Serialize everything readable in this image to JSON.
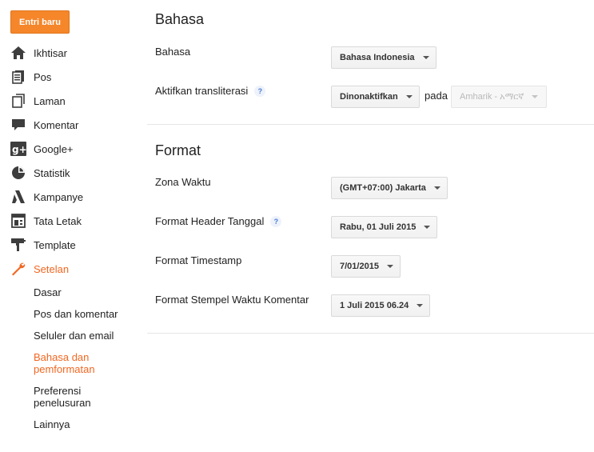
{
  "sidebar": {
    "new_post_label": "Entri baru",
    "items": [
      {
        "label": "Ikhtisar",
        "icon": "home-icon"
      },
      {
        "label": "Pos",
        "icon": "posts-icon"
      },
      {
        "label": "Laman",
        "icon": "pages-icon"
      },
      {
        "label": "Komentar",
        "icon": "comment-icon"
      },
      {
        "label": "Google+",
        "icon": "google-plus-icon"
      },
      {
        "label": "Statistik",
        "icon": "stats-icon"
      },
      {
        "label": "Kampanye",
        "icon": "campaign-icon"
      },
      {
        "label": "Tata Letak",
        "icon": "layout-icon"
      },
      {
        "label": "Template",
        "icon": "template-icon"
      },
      {
        "label": "Setelan",
        "icon": "wrench-icon"
      }
    ],
    "sub_items": [
      {
        "label": "Dasar"
      },
      {
        "label": "Pos dan komentar"
      },
      {
        "label": "Seluler dan email"
      },
      {
        "label": "Bahasa dan pemformatan"
      },
      {
        "label": "Preferensi penelusuran"
      },
      {
        "label": "Lainnya"
      }
    ],
    "accent_color": "#f26722"
  },
  "language_section": {
    "title": "Bahasa",
    "language_label": "Bahasa",
    "language_value": "Bahasa Indonesia",
    "transliteration_label": "Aktifkan transliterasi",
    "transliteration_help": "?",
    "transliteration_value": "Dinonaktifkan",
    "pada_label": "pada",
    "transliteration_language_value": "Amharik - አማርኛ"
  },
  "format_section": {
    "title": "Format",
    "timezone_label": "Zona Waktu",
    "timezone_value": "(GMT+07:00) Jakarta",
    "date_header_label": "Format Header Tanggal",
    "date_header_help": "?",
    "date_header_value": "Rabu, 01 Juli 2015",
    "timestamp_label": "Format Timestamp",
    "timestamp_value": "7/01/2015",
    "comment_timestamp_label": "Format Stempel Waktu Komentar",
    "comment_timestamp_value": "1 Juli 2015 06.24"
  }
}
